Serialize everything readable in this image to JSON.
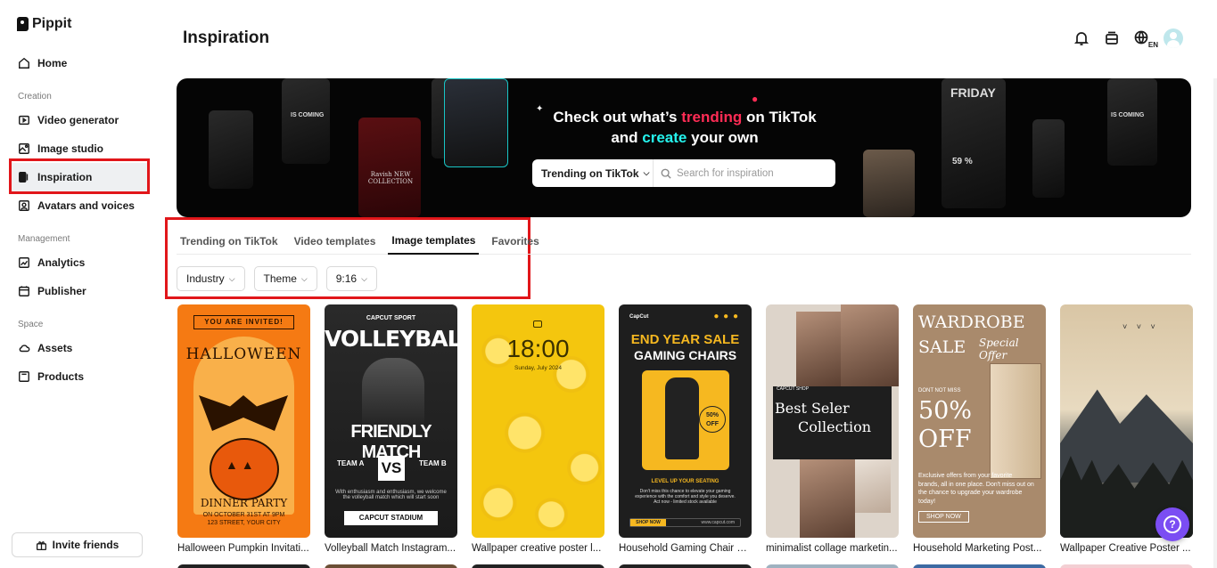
{
  "app": {
    "name": "Pippit"
  },
  "sidebar": {
    "home": "Home",
    "sections": {
      "creation": "Creation",
      "management": "Management",
      "space": "Space"
    },
    "creation_items": [
      "Video generator",
      "Image studio",
      "Inspiration",
      "Avatars and voices"
    ],
    "management_items": [
      "Analytics",
      "Publisher"
    ],
    "space_items": [
      "Assets",
      "Products"
    ],
    "active_item": "Inspiration",
    "invite_label": "Invite friends"
  },
  "header": {
    "title": "Inspiration",
    "lang_badge": "EN",
    "icons": [
      "bell-icon",
      "inbox-icon",
      "globe-icon",
      "avatar"
    ]
  },
  "banner": {
    "heading_part1": "Check out what’s ",
    "heading_trending": "trending",
    "heading_part2": " on TikTok",
    "heading_and": "and ",
    "heading_create": "create",
    "heading_part3": " your own",
    "search_scope": "Trending on TikTok",
    "search_placeholder": "Search for inspiration",
    "phone_texts": [
      "IS COMING",
      "Ravish NEW COLLECTION",
      "FRIDAY",
      "59 %",
      "IS COMING"
    ],
    "colors": {
      "pink": "#fe2c55",
      "cyan": "#25f4ee"
    }
  },
  "tabs": {
    "items": [
      "Trending on TikTok",
      "Video templates",
      "Image templates",
      "Favorites"
    ],
    "active": "Image templates"
  },
  "filters": [
    "Industry",
    "Theme",
    "9:16"
  ],
  "cards": [
    {
      "caption": "Halloween Pumpkin Invitati...",
      "art": {
        "top": "YOU ARE INVITED!",
        "title": "HALLOWEEN",
        "sub": "DINNER PARTY",
        "details": "ON OCTOBER 31ST AT 9PM\n123 STREET, YOUR CITY"
      }
    },
    {
      "caption": "Volleyball Match Instagram...",
      "art": {
        "sport": "CAPCUT SPORT",
        "title": "VOLLEYBALL",
        "sub": "FRIENDLY MATCH",
        "team_a": "TEAM A",
        "vs": "VS",
        "team_b": "TEAM B",
        "copy": "With enthusiasm and enthusiasm, we welcome the volleyball match which will start soon",
        "stadium": "CAPCUT STADIUM"
      }
    },
    {
      "caption": "Wallpaper creative poster l...",
      "art": {
        "time": "18:00",
        "date": "Sunday, July 2024"
      }
    },
    {
      "caption": "Household Gaming Chair S...",
      "art": {
        "brand": "CapCut",
        "title1": "END YEAR SALE",
        "title2": "GAMING CHAIRS",
        "badge": "50% OFF",
        "tagline": "LEVEL UP YOUR SEATING",
        "copy": "Don't miss this chance to elevate your gaming experience with the comfort and style you deserve. Act now - limited stock available",
        "button": "SHOP NOW",
        "url": "www.capcut.com"
      }
    },
    {
      "caption": "minimalist collage marketin...",
      "art": {
        "shop": "CAPCUT SHOP",
        "title1": "Best Seler",
        "title2": "Collection"
      }
    },
    {
      "caption": "Household Marketing Post...",
      "art": {
        "title1": "WARDROBE",
        "title2": "SALE",
        "special": "Special Offer",
        "note": "DONT NOT MISS",
        "pct": "50%",
        "off": "OFF",
        "copy": "Exclusive offers from your favorite brands, all in one place. Don't miss out on the chance to upgrade your wardrobe today!",
        "button": "SHOP NOW"
      }
    },
    {
      "caption": "Wallpaper Creative Poster ...",
      "art": {}
    }
  ],
  "help": {
    "icon": "question-icon"
  }
}
